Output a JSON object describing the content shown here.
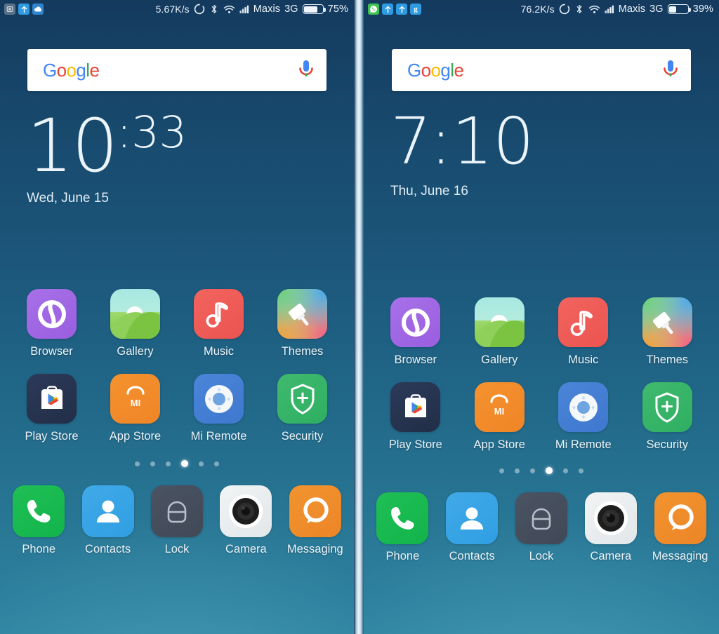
{
  "panels": [
    {
      "id": "left-screen",
      "status_bar": {
        "notifications": [
          {
            "name": "screenshot-icon",
            "glyph": "⬛",
            "color": "#5a7287"
          },
          {
            "name": "upload-arrow-icon",
            "glyph": "↑",
            "color": "#2e9ae0"
          },
          {
            "name": "cloud-sync-icon",
            "glyph": "☁",
            "color": "#2f86cf"
          }
        ],
        "network_speed": "5.67K/s",
        "sync_icon": "sync-circle-icon",
        "bluetooth_icon": "bluetooth-icon",
        "wifi_icon": "wifi-icon",
        "signal_icon": "cellular-signal-icon",
        "carrier": "Maxis",
        "network_type": "3G",
        "battery_percent": "75%",
        "battery_level": 75
      },
      "search_widget": {
        "logo_letters": [
          "G",
          "o",
          "o",
          "g",
          "l",
          "e"
        ],
        "mic_icon": "microphone-icon"
      },
      "clock": {
        "hours": "10",
        "minutes": ":33",
        "date": "Wed, June 15"
      },
      "apps": [
        {
          "label": "Browser",
          "icon": "browser-icon",
          "style": "ic-browser"
        },
        {
          "label": "Gallery",
          "icon": "gallery-icon",
          "style": "ic-gallery"
        },
        {
          "label": "Music",
          "icon": "music-icon",
          "style": "ic-music"
        },
        {
          "label": "Themes",
          "icon": "themes-icon",
          "style": "ic-themes"
        },
        {
          "label": "Play Store",
          "icon": "play-store-icon",
          "style": "ic-play"
        },
        {
          "label": "App Store",
          "icon": "app-store-icon",
          "style": "ic-appstore"
        },
        {
          "label": "Mi Remote",
          "icon": "mi-remote-icon",
          "style": "ic-remote"
        },
        {
          "label": "Security",
          "icon": "security-icon",
          "style": "ic-security"
        }
      ],
      "page_dots": {
        "count": 6,
        "active_index": 3
      },
      "dock": [
        {
          "label": "Phone",
          "icon": "phone-icon",
          "style": "ic-phone"
        },
        {
          "label": "Contacts",
          "icon": "contacts-icon",
          "style": "ic-contacts"
        },
        {
          "label": "Lock",
          "icon": "lock-icon",
          "style": "ic-lock"
        },
        {
          "label": "Camera",
          "icon": "camera-icon",
          "style": "ic-camera"
        },
        {
          "label": "Messaging",
          "icon": "messaging-icon",
          "style": "ic-messaging"
        }
      ]
    },
    {
      "id": "right-screen",
      "status_bar": {
        "notifications": [
          {
            "name": "whatsapp-icon",
            "glyph": "✆",
            "color": "#3fc351"
          },
          {
            "name": "upload-arrow-icon",
            "glyph": "↑",
            "color": "#2e9ae0"
          },
          {
            "name": "upload-arrow-icon",
            "glyph": "↑",
            "color": "#2e9ae0"
          },
          {
            "name": "google-g-icon",
            "glyph": "g",
            "color": "#2f86cf"
          }
        ],
        "network_speed": "76.2K/s",
        "sync_icon": "sync-circle-icon",
        "bluetooth_icon": "bluetooth-icon",
        "wifi_icon": "wifi-icon",
        "signal_icon": "cellular-signal-icon",
        "carrier": "Maxis",
        "network_type": "3G",
        "battery_percent": "39%",
        "battery_level": 39
      },
      "search_widget": {
        "logo_letters": [
          "G",
          "o",
          "o",
          "g",
          "l",
          "e"
        ],
        "mic_icon": "microphone-icon"
      },
      "clock": {
        "hours": "7",
        "minutes": ":10",
        "date": "Thu, June 16"
      },
      "apps": [
        {
          "label": "Browser",
          "icon": "browser-icon",
          "style": "ic-browser"
        },
        {
          "label": "Gallery",
          "icon": "gallery-icon",
          "style": "ic-gallery"
        },
        {
          "label": "Music",
          "icon": "music-icon",
          "style": "ic-music"
        },
        {
          "label": "Themes",
          "icon": "themes-icon",
          "style": "ic-themes"
        },
        {
          "label": "Play Store",
          "icon": "play-store-icon",
          "style": "ic-play"
        },
        {
          "label": "App Store",
          "icon": "app-store-icon",
          "style": "ic-appstore"
        },
        {
          "label": "Mi Remote",
          "icon": "mi-remote-icon",
          "style": "ic-remote"
        },
        {
          "label": "Security",
          "icon": "security-icon",
          "style": "ic-security"
        }
      ],
      "page_dots": {
        "count": 6,
        "active_index": 3
      },
      "dock": [
        {
          "label": "Phone",
          "icon": "phone-icon",
          "style": "ic-phone"
        },
        {
          "label": "Contacts",
          "icon": "contacts-icon",
          "style": "ic-contacts"
        },
        {
          "label": "Lock",
          "icon": "lock-icon",
          "style": "ic-lock"
        },
        {
          "label": "Camera",
          "icon": "camera-icon",
          "style": "ic-camera"
        },
        {
          "label": "Messaging",
          "icon": "messaging-icon",
          "style": "ic-messaging"
        }
      ]
    }
  ],
  "theme": {
    "wallpaper_top": "#143a5e",
    "wallpaper_bottom": "#2e83a0",
    "status_text": "#eaf2f8",
    "label_text": "#eaf4fa"
  }
}
